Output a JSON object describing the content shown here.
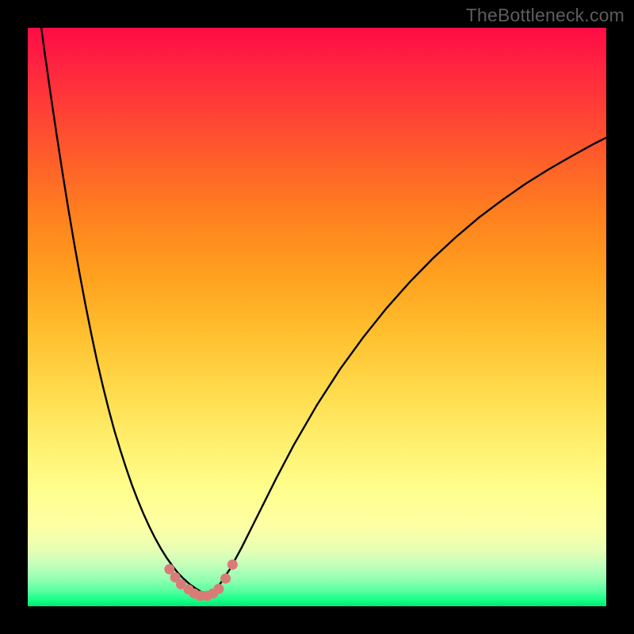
{
  "watermark": "TheBottleneck.com",
  "colors": {
    "background": "#000000",
    "gradient_top": "#ff0b46",
    "gradient_bottom": "#00e86f",
    "curve": "#000000",
    "markers": "#d97c78"
  },
  "chart_data": {
    "type": "line",
    "title": "",
    "xlabel": "",
    "ylabel": "",
    "xlim": [
      0,
      100
    ],
    "ylim": [
      0,
      100
    ],
    "grid": false,
    "legend": false,
    "x": [
      0,
      1,
      2,
      3,
      4,
      5,
      6,
      7,
      8,
      9,
      10,
      11,
      12,
      13,
      14,
      15,
      16,
      17,
      18,
      19,
      20,
      21,
      22,
      23,
      24,
      25,
      26,
      27,
      28,
      29,
      30,
      31,
      32,
      33,
      35,
      37,
      40,
      43,
      46,
      50,
      54,
      58,
      62,
      66,
      70,
      74,
      78,
      82,
      86,
      90,
      94,
      98,
      100
    ],
    "y": [
      118,
      110,
      102.5,
      95.2,
      88.2,
      81.5,
      75,
      68.8,
      62.9,
      57.3,
      52,
      47,
      42.3,
      38,
      34,
      30.3,
      27,
      23.9,
      21,
      18.4,
      16,
      13.8,
      11.8,
      10,
      8.4,
      7,
      5.7,
      4.7,
      3.8,
      3.1,
      2.5,
      2.1,
      2.5,
      3.5,
      6.5,
      10.2,
      16.2,
      22.2,
      27.9,
      34.8,
      41,
      46.5,
      51.5,
      56,
      60.1,
      63.8,
      67.2,
      70.2,
      73,
      75.5,
      77.8,
      80,
      81
    ],
    "markers": {
      "x": [
        24.5,
        25.5,
        26.5,
        27.8,
        28.8,
        29.8,
        31.0,
        32.0,
        33.0,
        34.2,
        35.4
      ],
      "y": [
        6.4,
        5.0,
        3.8,
        2.9,
        2.2,
        1.8,
        1.8,
        2.2,
        3.0,
        4.8,
        7.2
      ]
    }
  }
}
